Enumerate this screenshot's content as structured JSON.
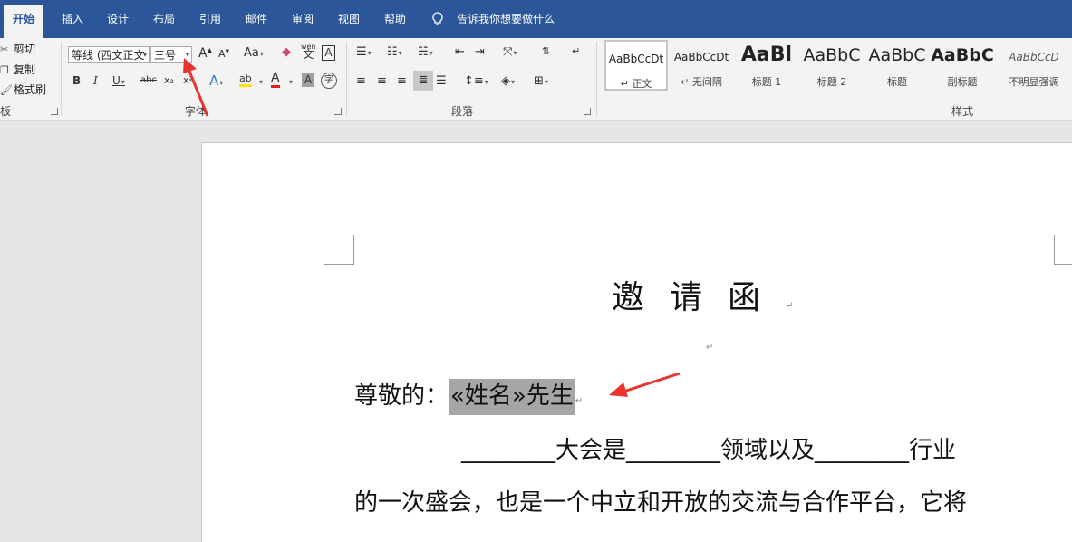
{
  "tabs": [
    {
      "label": "开始",
      "active": true
    },
    {
      "label": "插入"
    },
    {
      "label": "设计"
    },
    {
      "label": "布局"
    },
    {
      "label": "引用"
    },
    {
      "label": "邮件"
    },
    {
      "label": "审阅"
    },
    {
      "label": "视图"
    },
    {
      "label": "帮助"
    }
  ],
  "tell_me": "告诉我你想要做什么",
  "clipboard": {
    "cut": "剪切",
    "copy": "复制",
    "format_painter": "格式刷",
    "group_label": "板"
  },
  "font": {
    "font_name": "等线 (西文正文",
    "font_size": "三号",
    "group_label": "字体",
    "bold": "B",
    "italic": "I",
    "underline": "U",
    "strike": "abc",
    "subscript": "x₂",
    "superscript": "x²",
    "grow": "A",
    "shrink": "A",
    "change_case": "Aa",
    "phonetic_top": "wén",
    "phonetic_bottom": "文",
    "border_char": "A",
    "text_effect": "A",
    "highlight": "ab",
    "font_color": "A",
    "shading_char": "A",
    "enclose": "字"
  },
  "paragraph": {
    "group_label": "段落"
  },
  "styles": {
    "group_label": "样式",
    "items": [
      {
        "sample": "AaBbCcDt",
        "name": "↵ 正文",
        "selected": true
      },
      {
        "sample": "AaBbCcDt",
        "name": "↵ 无间隔"
      },
      {
        "sample": "AaBl",
        "name": "标题 1"
      },
      {
        "sample": "AaBbC",
        "name": "标题 2"
      },
      {
        "sample": "AaBbC",
        "name": "标题"
      },
      {
        "sample": "AaBbC",
        "name": "副标题"
      },
      {
        "sample": "AaBbCcD",
        "name": "不明显强调"
      }
    ]
  },
  "document": {
    "title": "邀请函",
    "pilcrow": "↵",
    "salutation": "尊敬的：",
    "merge_field": "«姓名»先生",
    "line1": {
      "blank": "________",
      "text1": "大会是",
      "text2": "领域以及",
      "text3": "行业"
    },
    "line2": "的一次盛会，也是一个中立和开放的交流与合作平台，它将"
  },
  "colors": {
    "tab_bar": "#2b579a",
    "ribbon": "#f3f3f3",
    "workspace": "#e6e6e6",
    "annotation_arrow": "#e8332e",
    "merge_highlight": "#a6a6a6"
  }
}
